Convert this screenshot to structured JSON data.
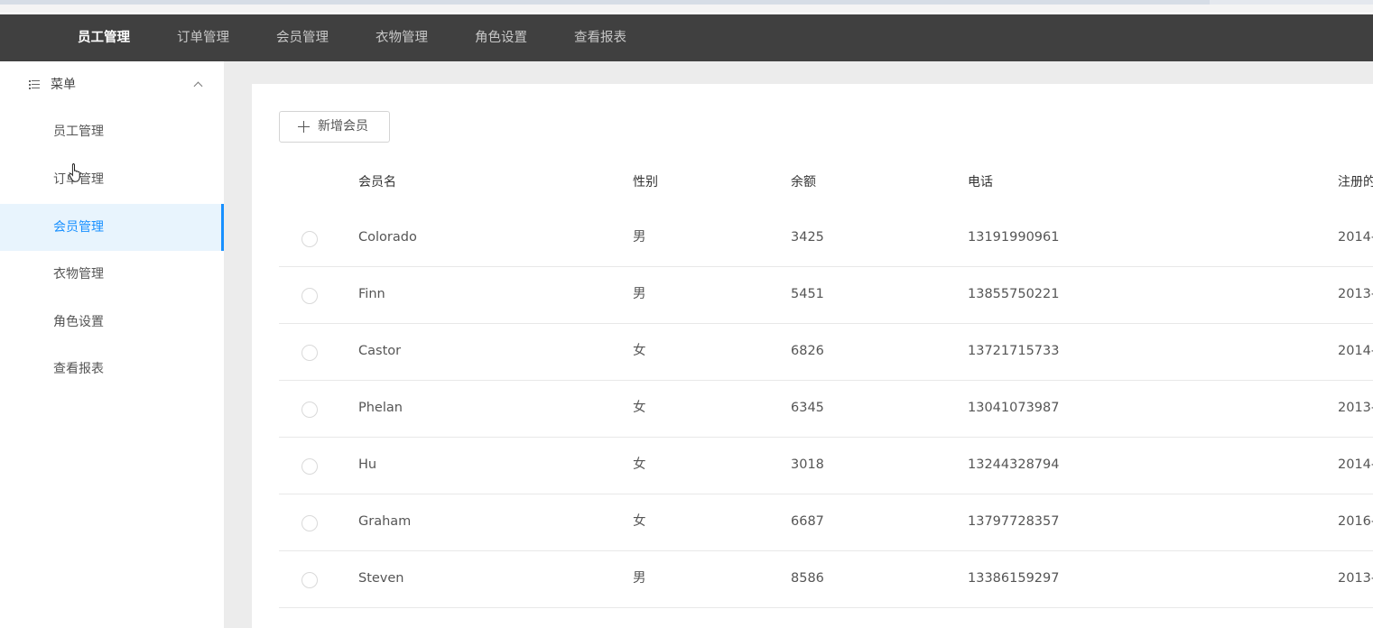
{
  "topnav": {
    "items": [
      {
        "label": "员工管理",
        "active": true
      },
      {
        "label": "订单管理",
        "active": false
      },
      {
        "label": "会员管理",
        "active": false
      },
      {
        "label": "衣物管理",
        "active": false
      },
      {
        "label": "角色设置",
        "active": false
      },
      {
        "label": "查看报表",
        "active": false
      }
    ]
  },
  "sidebar": {
    "menu_title": "菜单",
    "menu_icon": "list-icon",
    "collapse_icon": "chevron-up-icon",
    "items": [
      {
        "label": "员工管理",
        "active": false
      },
      {
        "label": "订单管理",
        "active": false
      },
      {
        "label": "会员管理",
        "active": true
      },
      {
        "label": "衣物管理",
        "active": false
      },
      {
        "label": "角色设置",
        "active": false
      },
      {
        "label": "查看报表",
        "active": false
      }
    ]
  },
  "main": {
    "add_button_label": "新增会员",
    "add_button_icon": "plus-icon",
    "columns": [
      "会员名",
      "性别",
      "余额",
      "电话",
      "注册的"
    ],
    "rows": [
      {
        "name": "Colorado",
        "gender": "男",
        "balance": "3425",
        "phone": "13191990961",
        "date": "2014-"
      },
      {
        "name": "Finn",
        "gender": "男",
        "balance": "5451",
        "phone": "13855750221",
        "date": "2013-"
      },
      {
        "name": "Castor",
        "gender": "女",
        "balance": "6826",
        "phone": "13721715733",
        "date": "2014-"
      },
      {
        "name": "Phelan",
        "gender": "女",
        "balance": "6345",
        "phone": "13041073987",
        "date": "2013-"
      },
      {
        "name": "Hu",
        "gender": "女",
        "balance": "3018",
        "phone": "13244328794",
        "date": "2014-"
      },
      {
        "name": "Graham",
        "gender": "女",
        "balance": "6687",
        "phone": "13797728357",
        "date": "2016-"
      },
      {
        "name": "Steven",
        "gender": "男",
        "balance": "8586",
        "phone": "13386159297",
        "date": "2013-"
      }
    ]
  },
  "colors": {
    "topnav_bg": "#404040",
    "accent": "#1890ff",
    "active_item_bg": "#e8f4fd",
    "content_bg": "#ececec"
  }
}
